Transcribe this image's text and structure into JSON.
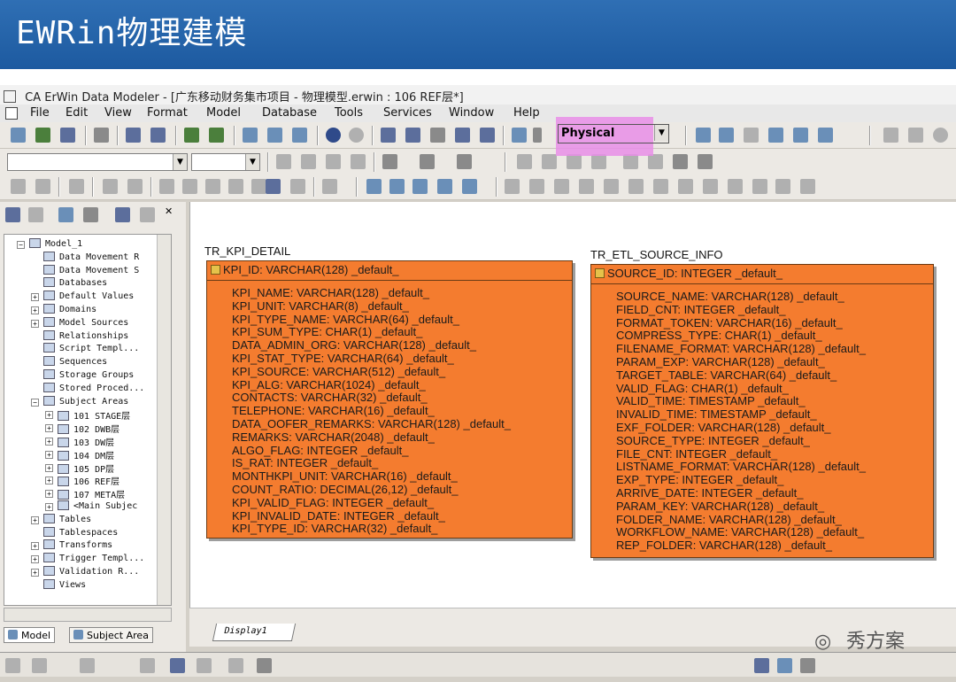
{
  "slide": {
    "title": "EWRin物理建模"
  },
  "window": {
    "title": "CA ErWin Data Modeler - [广东移动财务集市项目 - 物理模型.erwin : 106 REF层*]"
  },
  "menu": [
    "File",
    "Edit",
    "View",
    "Format",
    "Model",
    "Database",
    "Tools",
    "Services",
    "Window",
    "Help"
  ],
  "toolbar": {
    "model_type": "Physical"
  },
  "tree": {
    "items": [
      {
        "label": "Model_1",
        "icon": "model-icon"
      },
      {
        "label": "Data Movement R",
        "icon": "data-movement-icon"
      },
      {
        "label": "Data Movement S",
        "icon": "data-movement-icon"
      },
      {
        "label": "Databases",
        "icon": "database-icon"
      },
      {
        "label": "Default Values",
        "icon": "default-values-icon"
      },
      {
        "label": "Domains",
        "icon": "domain-icon"
      },
      {
        "label": "Model Sources",
        "icon": "model-source-icon"
      },
      {
        "label": "Relationships",
        "icon": "relationship-icon"
      },
      {
        "label": "Script Templ...",
        "icon": "script-icon"
      },
      {
        "label": "Sequences",
        "icon": "sequence-icon"
      },
      {
        "label": "Storage Groups",
        "icon": "storage-icon"
      },
      {
        "label": "Stored Proced...",
        "icon": "procedure-icon"
      },
      {
        "label": "Subject Areas",
        "icon": "subject-area-icon"
      },
      {
        "label": "101 STAGE层",
        "icon": "subject-area-icon"
      },
      {
        "label": "102 DWB层",
        "icon": "subject-area-icon"
      },
      {
        "label": "103 DW层",
        "icon": "subject-area-icon"
      },
      {
        "label": "104 DM层",
        "icon": "subject-area-icon"
      },
      {
        "label": "105 DP层",
        "icon": "subject-area-icon"
      },
      {
        "label": "106 REF层",
        "icon": "subject-area-icon"
      },
      {
        "label": "107 META层",
        "icon": "subject-area-icon"
      },
      {
        "label": "<Main Subjec",
        "icon": "subject-area-icon"
      },
      {
        "label": "Tables",
        "icon": "table-icon"
      },
      {
        "label": "Tablespaces",
        "icon": "tablespace-icon"
      },
      {
        "label": "Transforms",
        "icon": "transform-icon"
      },
      {
        "label": "Trigger Templ...",
        "icon": "trigger-icon"
      },
      {
        "label": "Validation R...",
        "icon": "validation-icon"
      },
      {
        "label": "Views",
        "icon": "view-icon"
      }
    ]
  },
  "panel_tabs": {
    "model": "Model",
    "subject_area": "Subject Area"
  },
  "entities": [
    {
      "name": "TR_KPI_DETAIL",
      "pk": "KPI_ID: VARCHAR(128) _default_",
      "attributes": [
        "KPI_NAME: VARCHAR(128) _default_",
        "KPI_UNIT: VARCHAR(8) _default_",
        "KPI_TYPE_NAME: VARCHAR(64) _default_",
        "KPI_SUM_TYPE: CHAR(1) _default_",
        "DATA_ADMIN_ORG: VARCHAR(128) _default_",
        "KPI_STAT_TYPE: VARCHAR(64) _default_",
        "KPI_SOURCE: VARCHAR(512) _default_",
        "KPI_ALG: VARCHAR(1024) _default_",
        "CONTACTS: VARCHAR(32) _default_",
        "TELEPHONE: VARCHAR(16) _default_",
        "DATA_OOFER_REMARKS: VARCHAR(128) _default_",
        "REMARKS: VARCHAR(2048) _default_",
        "ALGO_FLAG: INTEGER _default_",
        "IS_RAT: INTEGER _default_",
        "MONTHKPI_UNIT: VARCHAR(16) _default_",
        "COUNT_RATIO: DECIMAL(26,12) _default_",
        "KPI_VALID_FLAG: INTEGER _default_",
        "KPI_INVALID_DATE: INTEGER _default_",
        "KPI_TYPE_ID: VARCHAR(32) _default_"
      ]
    },
    {
      "name": "TR_ETL_SOURCE_INFO",
      "pk": "SOURCE_ID: INTEGER _default_",
      "attributes": [
        "SOURCE_NAME: VARCHAR(128) _default_",
        "FIELD_CNT: INTEGER _default_",
        "FORMAT_TOKEN: VARCHAR(16) _default_",
        "COMPRESS_TYPE: CHAR(1) _default_",
        "FILENAME_FORMAT: VARCHAR(128) _default_",
        "PARAM_EXP: VARCHAR(128) _default_",
        "TARGET_TABLE: VARCHAR(64) _default_",
        "VALID_FLAG: CHAR(1) _default_",
        "VALID_TIME: TIMESTAMP _default_",
        "INVALID_TIME: TIMESTAMP _default_",
        "EXF_FOLDER: VARCHAR(128) _default_",
        "SOURCE_TYPE: INTEGER _default_",
        "FILE_CNT: INTEGER _default_",
        "LISTNAME_FORMAT: VARCHAR(128) _default_",
        "EXP_TYPE: INTEGER _default_",
        "ARRIVE_DATE: INTEGER _default_",
        "PARAM_KEY: VARCHAR(128) _default_",
        "FOLDER_NAME: VARCHAR(128) _default_",
        "WORKFLOW_NAME: VARCHAR(128) _default_",
        "REP_FOLDER: VARCHAR(128) _default_"
      ]
    }
  ],
  "canvas_tab": "Display1",
  "watermark": "秀方案",
  "colors": {
    "entity_fill": "#f47c2f",
    "slide_header": "#1d5aa0",
    "highlight": "#e98ee8"
  }
}
